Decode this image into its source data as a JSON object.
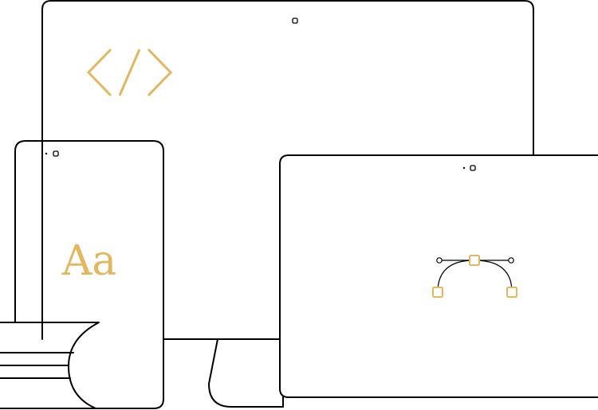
{
  "colors": {
    "outline": "#000000",
    "accent": "#e2b75f",
    "background": "#ffffff"
  },
  "icons": {
    "code": "code-brackets-icon",
    "typography": "typography-aa-icon",
    "vector": "bezier-curve-icon"
  },
  "phone": {
    "typography_sample": "Aa"
  }
}
